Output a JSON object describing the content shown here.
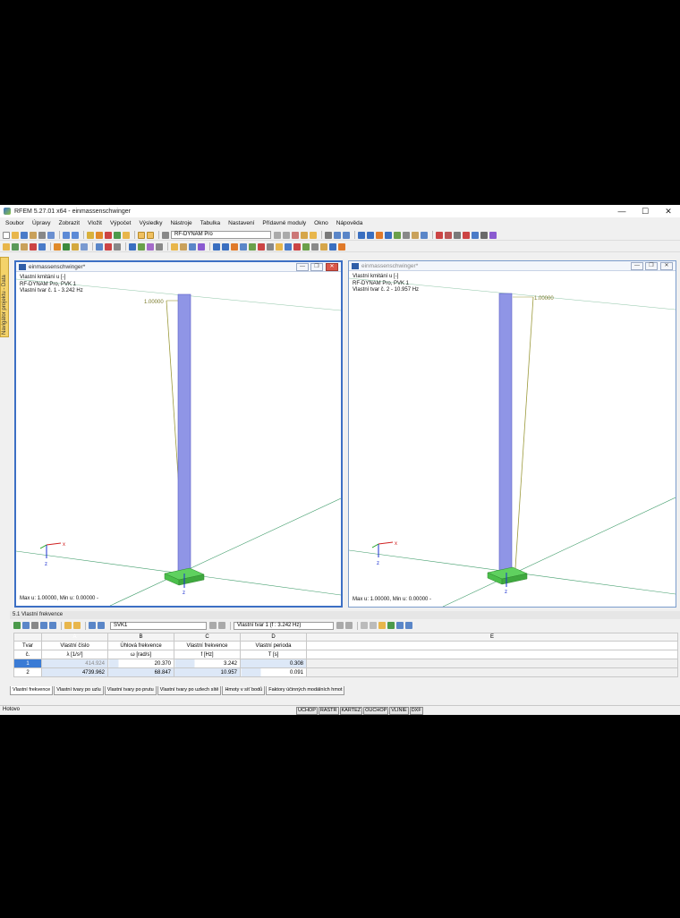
{
  "window": {
    "title": "RFEM 5.27.01 x64 - einmassenschwinger",
    "minimize": "—",
    "maximize": "☐",
    "close": "✕"
  },
  "menu": [
    "Soubor",
    "Úpravy",
    "Zobrazit",
    "Vložit",
    "Výpočet",
    "Výsledky",
    "Nástroje",
    "Tabulka",
    "Nastavení",
    "Přídavné moduly",
    "Okno",
    "Nápověda"
  ],
  "toolbar": {
    "module_combo": "RF-DYNAM Pro"
  },
  "navigator_tab": "Navigátor projektu - Data",
  "views": [
    {
      "title": "einmassenschwinger*",
      "info": [
        "Vlastní kmitání u [-]",
        "RF-DYNAM Pro, PVK 1",
        "Vlastní tvar č. 1 - 3.242 Hz"
      ],
      "max_value": "1.00000",
      "max_min": "Max u: 1.00000, Min u: 0.00000 -",
      "axis_x": "x",
      "axis_z": "z",
      "active": true
    },
    {
      "title": "einmassenschwinger*",
      "info": [
        "Vlastní kmitání u [-]",
        "RF-DYNAM Pro, PVK 1",
        "Vlastní tvar č. 2 - 10.957 Hz"
      ],
      "max_value": "1.00000",
      "max_min": "Max u: 1.00000, Min u: 0.00000 -",
      "axis_x": "x",
      "axis_z": "z",
      "active": false
    }
  ],
  "panel": {
    "title": "5.1 Vlastní frekvence",
    "case_combo": "SVK1",
    "mode_combo": "Vlastní tvar 1 (f : 3.242 Hz)",
    "columns": [
      "A",
      "B",
      "C",
      "D",
      "E"
    ],
    "headers": {
      "row_label": [
        "Tvar",
        "č."
      ],
      "eigen": [
        "Vlastní číslo",
        "λ [1/s²]"
      ],
      "angular": [
        "Úhlová frekvence",
        "ω [rad/s]"
      ],
      "freq": [
        "Vlastní frekvence",
        "f [Hz]"
      ],
      "period": [
        "Vlastní perioda",
        "T [s]"
      ]
    },
    "rows": [
      {
        "n": "1",
        "eigen": "414.924",
        "angular": "20.370",
        "freq": "3.242",
        "period": "0.308"
      },
      {
        "n": "2",
        "eigen": "4739.962",
        "angular": "68.847",
        "freq": "10.957",
        "period": "0.091"
      }
    ],
    "tabs": [
      "Vlastní frekvence",
      "Vlastní tvary po uzlu",
      "Vlastní tvary po prutu",
      "Vlastní tvary po uzlech sítě",
      "Hmoty v síť bodů",
      "Faktory účinných modálních hmot"
    ]
  },
  "status": {
    "ready": "Hotovo",
    "buttons": [
      "UCHOP",
      "RASTR",
      "KARTEZ",
      "OUCHOP",
      "VLINIE",
      "DXF"
    ]
  },
  "colors": {
    "member": "#8f95e6",
    "support": "#5fd15f",
    "mode_line": "#9c9a3c",
    "grid_line": "#3f9c6a",
    "selection": "#3a7bd5"
  }
}
